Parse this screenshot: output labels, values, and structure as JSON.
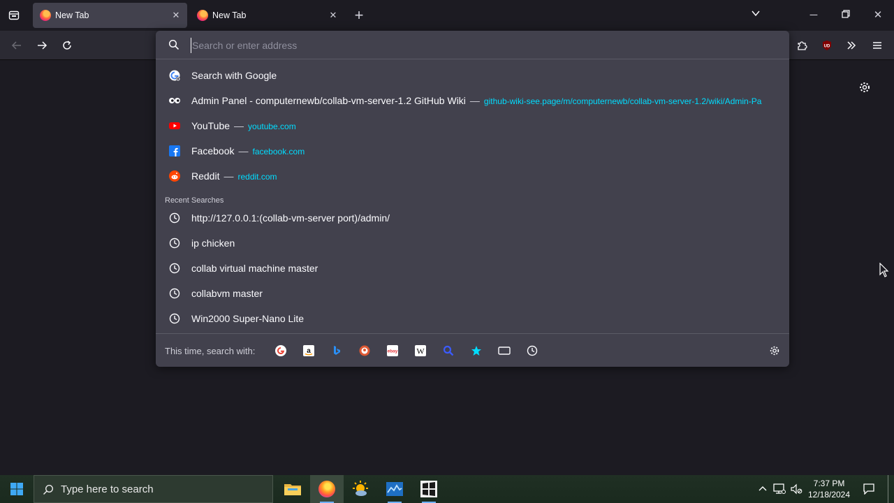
{
  "tabs": [
    {
      "title": "New Tab",
      "active": true
    },
    {
      "title": "New Tab",
      "active": false
    }
  ],
  "urlbar": {
    "placeholder": "Search or enter address",
    "value": ""
  },
  "suggestions": [
    {
      "icon": "google-icon",
      "title": "Search with Google",
      "url": ""
    },
    {
      "icon": "github-wiki-icon",
      "title": "Admin Panel - computernewb/collab-vm-server-1.2 GitHub Wiki",
      "url": "github-wiki-see.page/m/computernewb/collab-vm-server-1.2/wiki/Admin-Pa"
    },
    {
      "icon": "youtube-icon",
      "title": "YouTube",
      "url": "youtube.com"
    },
    {
      "icon": "facebook-icon",
      "title": "Facebook",
      "url": "facebook.com"
    },
    {
      "icon": "reddit-icon",
      "title": "Reddit",
      "url": "reddit.com"
    }
  ],
  "separator": "—",
  "recent_label": "Recent Searches",
  "recent_searches": [
    "http://127.0.0.1:(collab-vm-server port)/admin/",
    "ip chicken",
    "collab virtual machine master",
    "collabvm master",
    "Win2000 Super-Nano Lite"
  ],
  "oneoff_label": "This time, search with:",
  "oneoff_engines": [
    "google-icon",
    "amazon-icon",
    "bing-icon",
    "duckduckgo-icon",
    "ebay-icon",
    "wikipedia-icon",
    "search-icon",
    "bookmarks-star-icon",
    "tabs-icon",
    "history-icon"
  ],
  "taskbar": {
    "search_placeholder": "Type here to search",
    "time": "7:37 PM",
    "date": "12/18/2024"
  },
  "colors": {
    "accent_link": "#00ddff",
    "panel": "#42414d",
    "toolbar": "#2b2a33"
  }
}
